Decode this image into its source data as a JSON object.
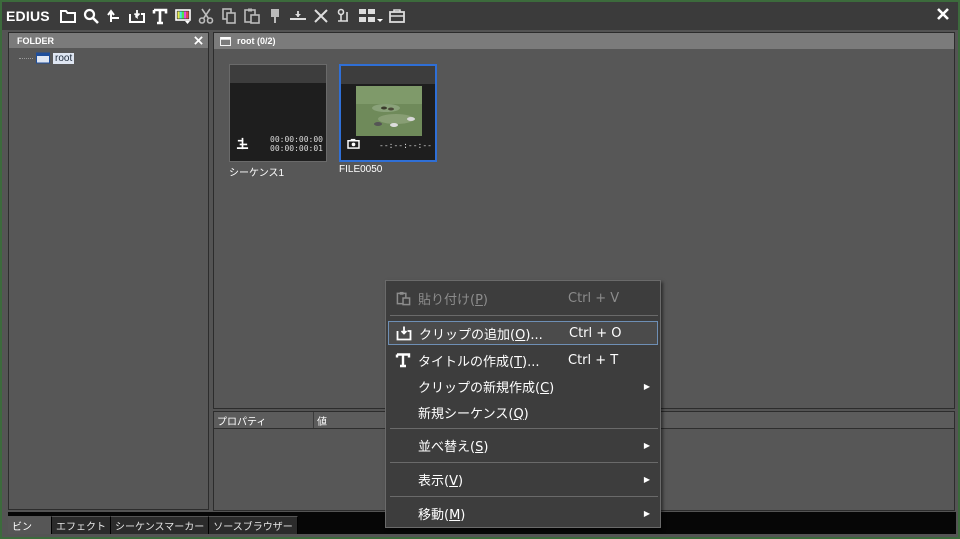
{
  "app": {
    "brand": "EDIUS"
  },
  "toolbar": {
    "icons": [
      "folder-icon",
      "search-icon",
      "up-icon",
      "add-clip-icon",
      "title-icon",
      "color-bars-icon",
      "scissors-icon",
      "copy-icon",
      "paste-icon",
      "marker-icon",
      "insert-icon",
      "delete-icon",
      "scene-detect-icon",
      "view-mode-icon",
      "dropdown-icon",
      "briefcase-icon"
    ]
  },
  "folder_panel": {
    "title": "FOLDER",
    "root_label": "root"
  },
  "bin": {
    "title": "root (0/2)",
    "clips": [
      {
        "name": "シーケンス1",
        "tc_in": "00:00:00:00",
        "tc_out": "00:00:00:01"
      },
      {
        "name": "FILE0050",
        "tc": "--:--:--:--"
      }
    ]
  },
  "properties": {
    "col_property": "プロパティ",
    "col_value": "値"
  },
  "tabs": [
    "ビン",
    "エフェクト",
    "シーケンスマーカー",
    "ソースブラウザー"
  ],
  "context_menu": {
    "paste": {
      "label": "貼り付け(",
      "key": "P",
      "end": ")",
      "shortcut": "Ctrl + V"
    },
    "add_clip": {
      "label": "クリップの追加(",
      "key": "O",
      "end": ")...",
      "shortcut": "Ctrl + O"
    },
    "create_title": {
      "label": "タイトルの作成(",
      "key": "T",
      "end": ")...",
      "shortcut": "Ctrl + T"
    },
    "new_clip": {
      "label": "クリップの新規作成(",
      "key": "C",
      "end": ")"
    },
    "new_sequence": {
      "label": "新規シーケンス(",
      "key": "Q",
      "end": ")"
    },
    "sort": {
      "label": "並べ替え(",
      "key": "S",
      "end": ")"
    },
    "view": {
      "label": "表示(",
      "key": "V",
      "end": ")"
    },
    "move": {
      "label": "移動(",
      "key": "M",
      "end": ")"
    }
  }
}
